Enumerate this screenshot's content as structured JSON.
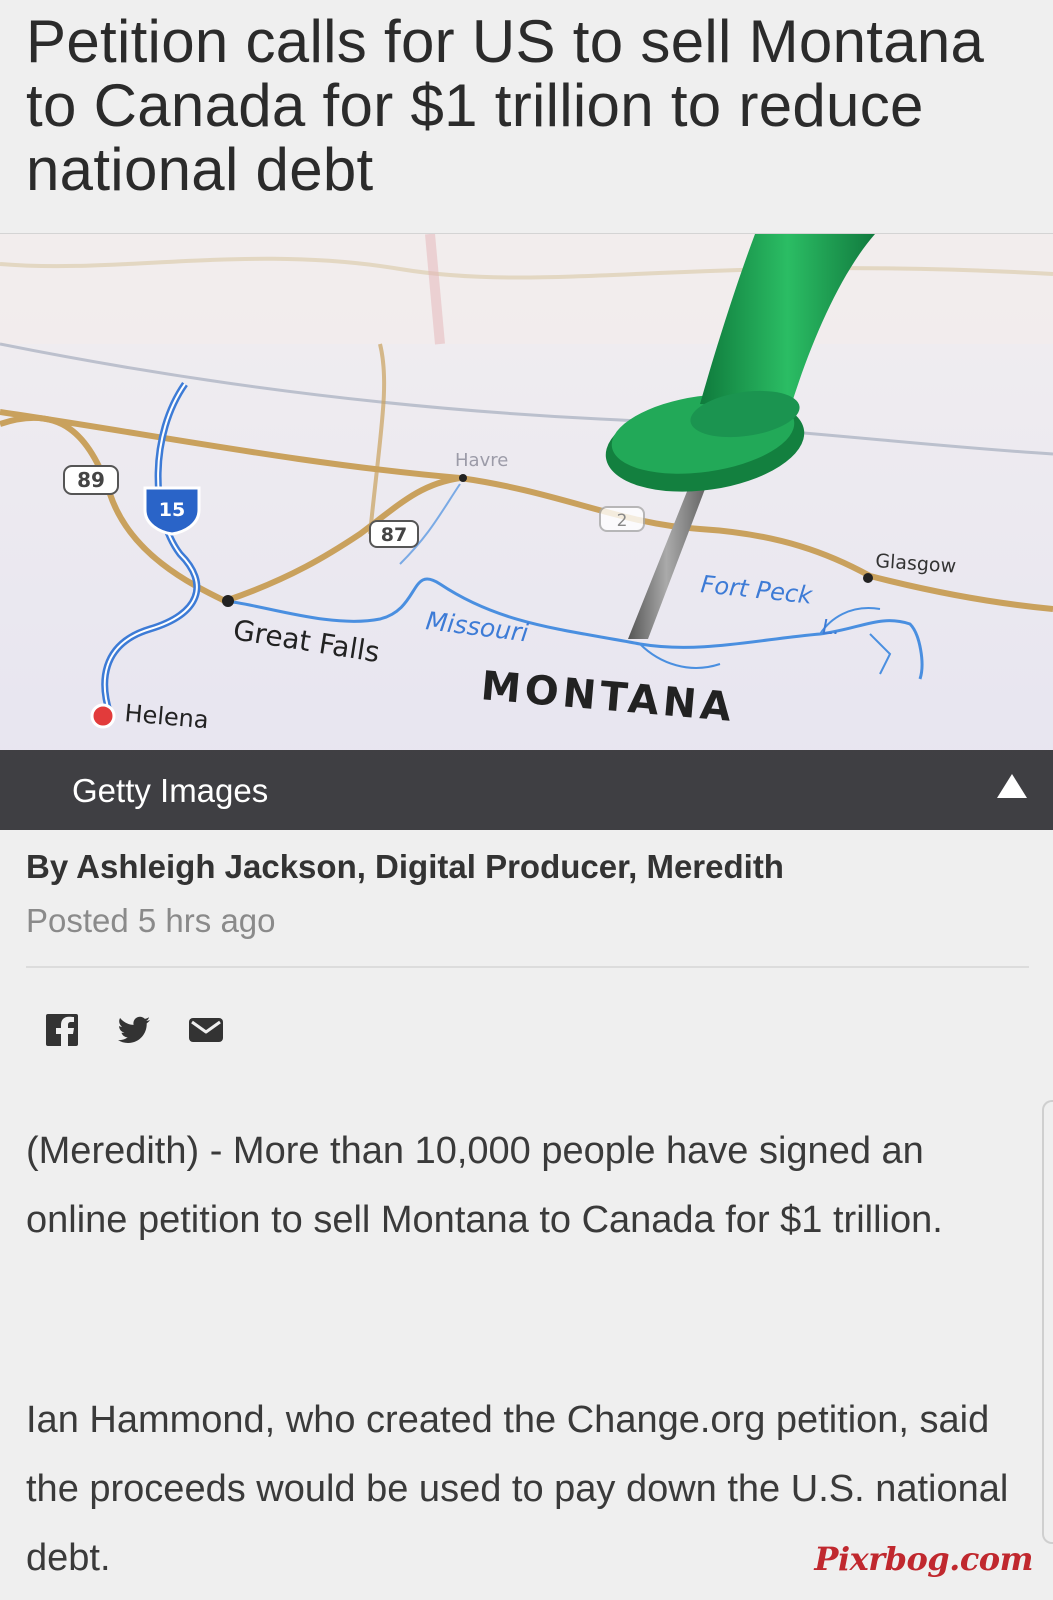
{
  "article": {
    "headline": "Petition calls for US to sell Montana to Canada for $1 trillion to reduce national debt",
    "image": {
      "credit": "Getty Images",
      "map_labels": {
        "route_89": "89",
        "route_15": "15",
        "route_87": "87",
        "route_2": "2",
        "havre": "Havre",
        "great_falls": "Great Falls",
        "missouri": "Missouri",
        "montana": "MONTANA",
        "helena": "Helena",
        "fort_peck": "Fort Peck",
        "fort_peck_l": "L.",
        "glasgow": "Glasgow"
      }
    },
    "byline": "By Ashleigh Jackson, Digital Producer, Meredith",
    "posted": "Posted 5 hrs ago",
    "share_icons": [
      "facebook-icon",
      "twitter-icon",
      "email-icon"
    ],
    "paragraphs": [
      "(Meredith) - More than 10,000 people have signed an online petition to sell Montana to Canada for $1 trillion.",
      "Ian Hammond, who created the Change.org petition, said the proceeds would be used to pay down the U.S. national debt."
    ]
  },
  "watermark": "Pixrbog.com",
  "colors": {
    "background": "#efefef",
    "pin_green": "#1f9a4f",
    "caption_bar": "#28282a",
    "watermark": "#c0282e"
  }
}
